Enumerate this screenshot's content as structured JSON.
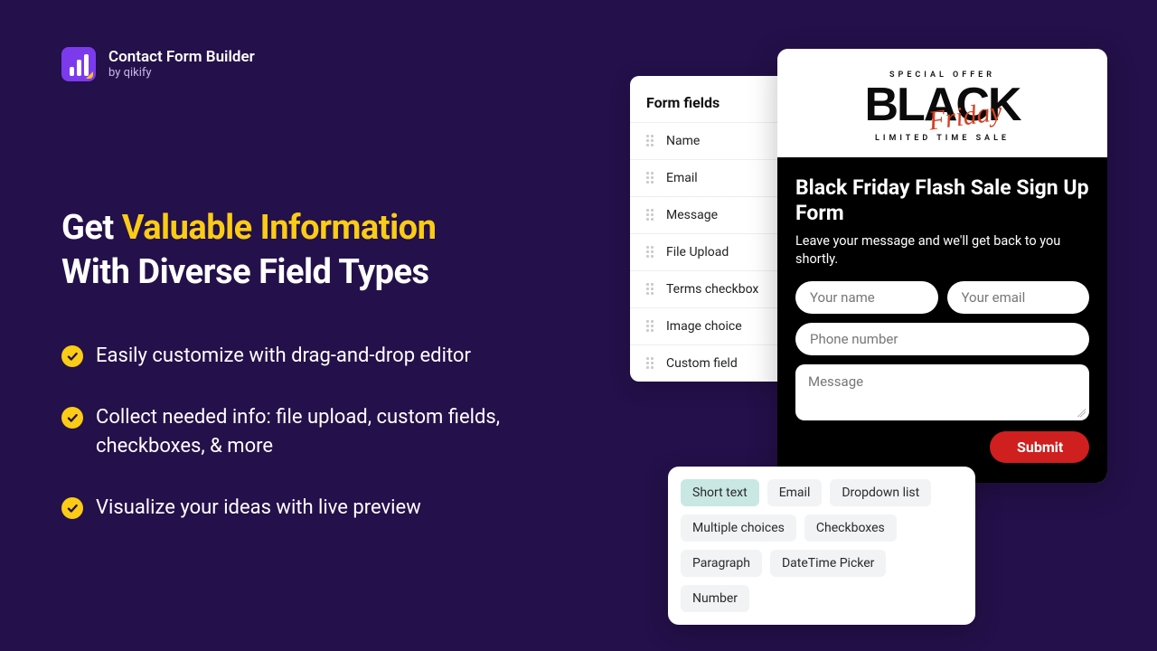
{
  "app": {
    "title": "Contact Form Builder",
    "byline": "by qikify"
  },
  "heading": {
    "prefix": "Get ",
    "accent": "Valuable Information",
    "line2": "With Diverse Field Types"
  },
  "features": [
    "Easily customize with drag-and-drop editor",
    "Collect needed info: file upload, custom fields, checkboxes, & more",
    "Visualize your ideas with live preview"
  ],
  "fields_panel": {
    "title": "Form fields",
    "items": [
      "Name",
      "Email",
      "Message",
      "File Upload",
      "Terms checkbox",
      "Image choice",
      "Custom field"
    ]
  },
  "promo": {
    "kicker": "SPECIAL OFFER",
    "brand_word": "BLACK",
    "brand_script": "Friday",
    "sub": "LIMITED TIME SALE",
    "form_title": "Black Friday Flash Sale Sign Up Form",
    "form_desc": "Leave your message and we'll get back to you shortly.",
    "placeholders": {
      "name": "Your name",
      "email": "Your email",
      "phone": "Phone number",
      "message": "Message"
    },
    "submit": "Submit"
  },
  "chips": [
    "Short text",
    "Email",
    "Dropdown list",
    "Multiple choices",
    "Checkboxes",
    "Paragraph",
    "DateTime Picker",
    "Number"
  ],
  "colors": {
    "bg": "#24104a",
    "accent": "#facc15",
    "submit": "#cf1f1f"
  }
}
